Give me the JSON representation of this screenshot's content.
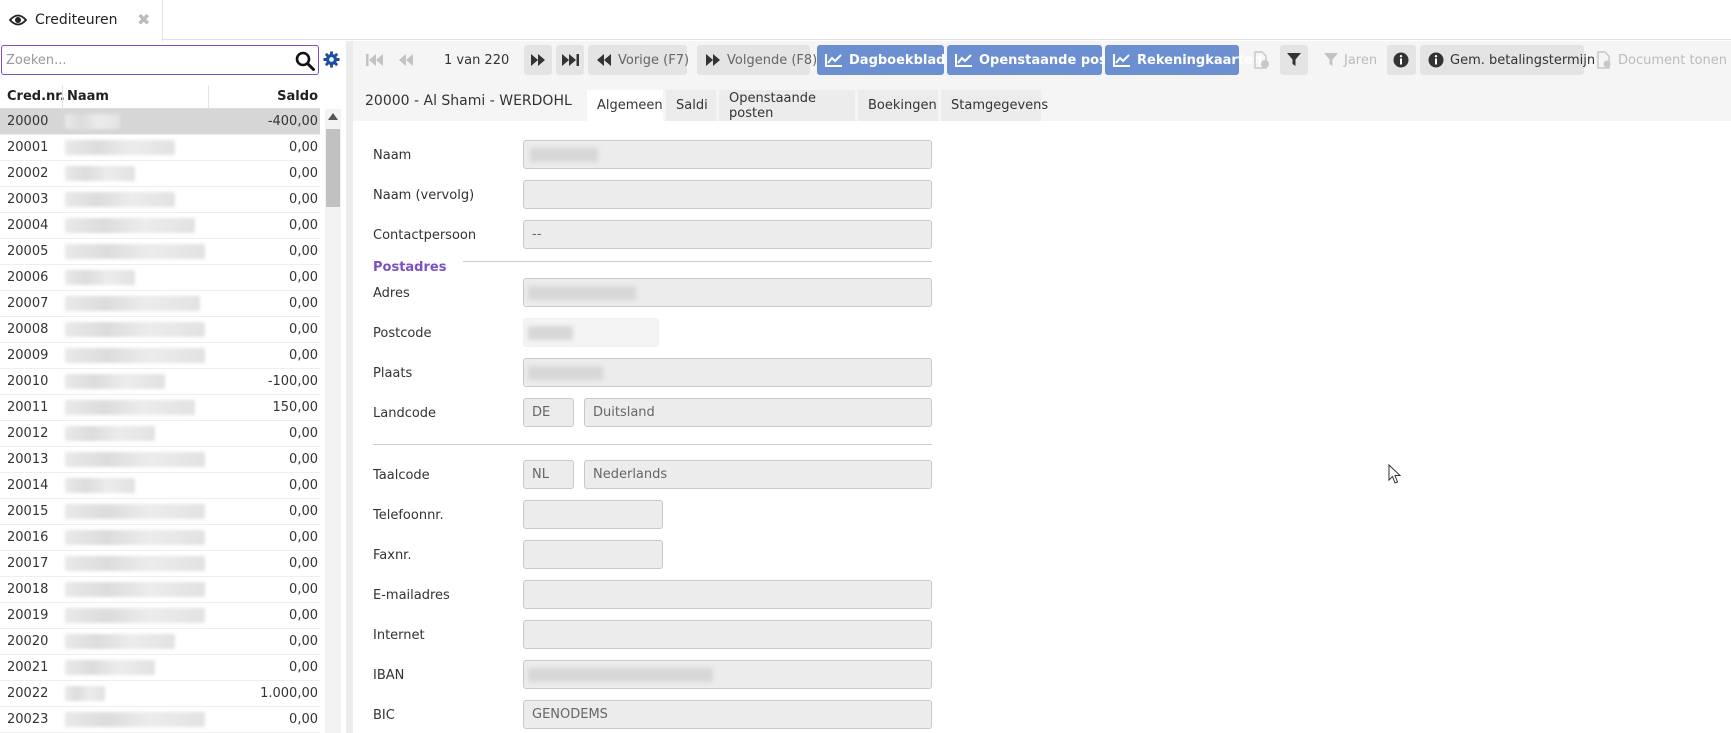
{
  "tab": {
    "label": "Crediteuren"
  },
  "search": {
    "placeholder": "Zoeken..."
  },
  "grid": {
    "headers": {
      "nr": "Cred.nr.",
      "naam": "Naam",
      "saldo": "Saldo"
    },
    "rows": [
      {
        "nr": "20000",
        "saldo": "-400,00"
      },
      {
        "nr": "20001",
        "saldo": "0,00"
      },
      {
        "nr": "20002",
        "saldo": "0,00"
      },
      {
        "nr": "20003",
        "saldo": "0,00"
      },
      {
        "nr": "20004",
        "saldo": "0,00"
      },
      {
        "nr": "20005",
        "saldo": "0,00"
      },
      {
        "nr": "20006",
        "saldo": "0,00"
      },
      {
        "nr": "20007",
        "saldo": "0,00"
      },
      {
        "nr": "20008",
        "saldo": "0,00"
      },
      {
        "nr": "20009",
        "saldo": "0,00"
      },
      {
        "nr": "20010",
        "saldo": "-100,00"
      },
      {
        "nr": "20011",
        "saldo": "150,00"
      },
      {
        "nr": "20012",
        "saldo": "0,00"
      },
      {
        "nr": "20013",
        "saldo": "0,00"
      },
      {
        "nr": "20014",
        "saldo": "0,00"
      },
      {
        "nr": "20015",
        "saldo": "0,00"
      },
      {
        "nr": "20016",
        "saldo": "0,00"
      },
      {
        "nr": "20017",
        "saldo": "0,00"
      },
      {
        "nr": "20018",
        "saldo": "0,00"
      },
      {
        "nr": "20019",
        "saldo": "0,00"
      },
      {
        "nr": "20020",
        "saldo": "0,00"
      },
      {
        "nr": "20021",
        "saldo": "0,00"
      },
      {
        "nr": "20022",
        "saldo": "1.000,00"
      },
      {
        "nr": "20023",
        "saldo": "0,00"
      }
    ]
  },
  "toolbar": {
    "counter": "1 van 220",
    "prev_label": "Vorige (F7)",
    "next_label": "Volgende (F8)",
    "dagboekbladen": "Dagboekbladen",
    "openstaande": "Openstaande posten",
    "rekeningkaarten": "Rekeningkaarten",
    "jaren": "Jaren",
    "betalingstermijn": "Gem. betalingstermijn",
    "document": "Document tonen"
  },
  "record": {
    "title": "20000 - Al Shami - WERDOHL",
    "tabs": [
      "Algemeen",
      "Saldi",
      "Openstaande posten",
      "Boekingen",
      "Stamgegevens"
    ]
  },
  "form": {
    "naam": "Naam",
    "naam_vervolg": "Naam (vervolg)",
    "contactpersoon": "Contactpersoon",
    "contactpersoon_value": "--",
    "postadres": "Postadres",
    "adres": "Adres",
    "postcode": "Postcode",
    "plaats": "Plaats",
    "landcode": "Landcode",
    "landcode_value": "DE",
    "land_value": "Duitsland",
    "taalcode": "Taalcode",
    "taalcode_value": "NL",
    "taal_value": "Nederlands",
    "telefoon": "Telefoonnr.",
    "fax": "Faxnr.",
    "email": "E-mailadres",
    "internet": "Internet",
    "iban": "IBAN",
    "bic": "BIC",
    "bic_value": "GENODEMS"
  }
}
